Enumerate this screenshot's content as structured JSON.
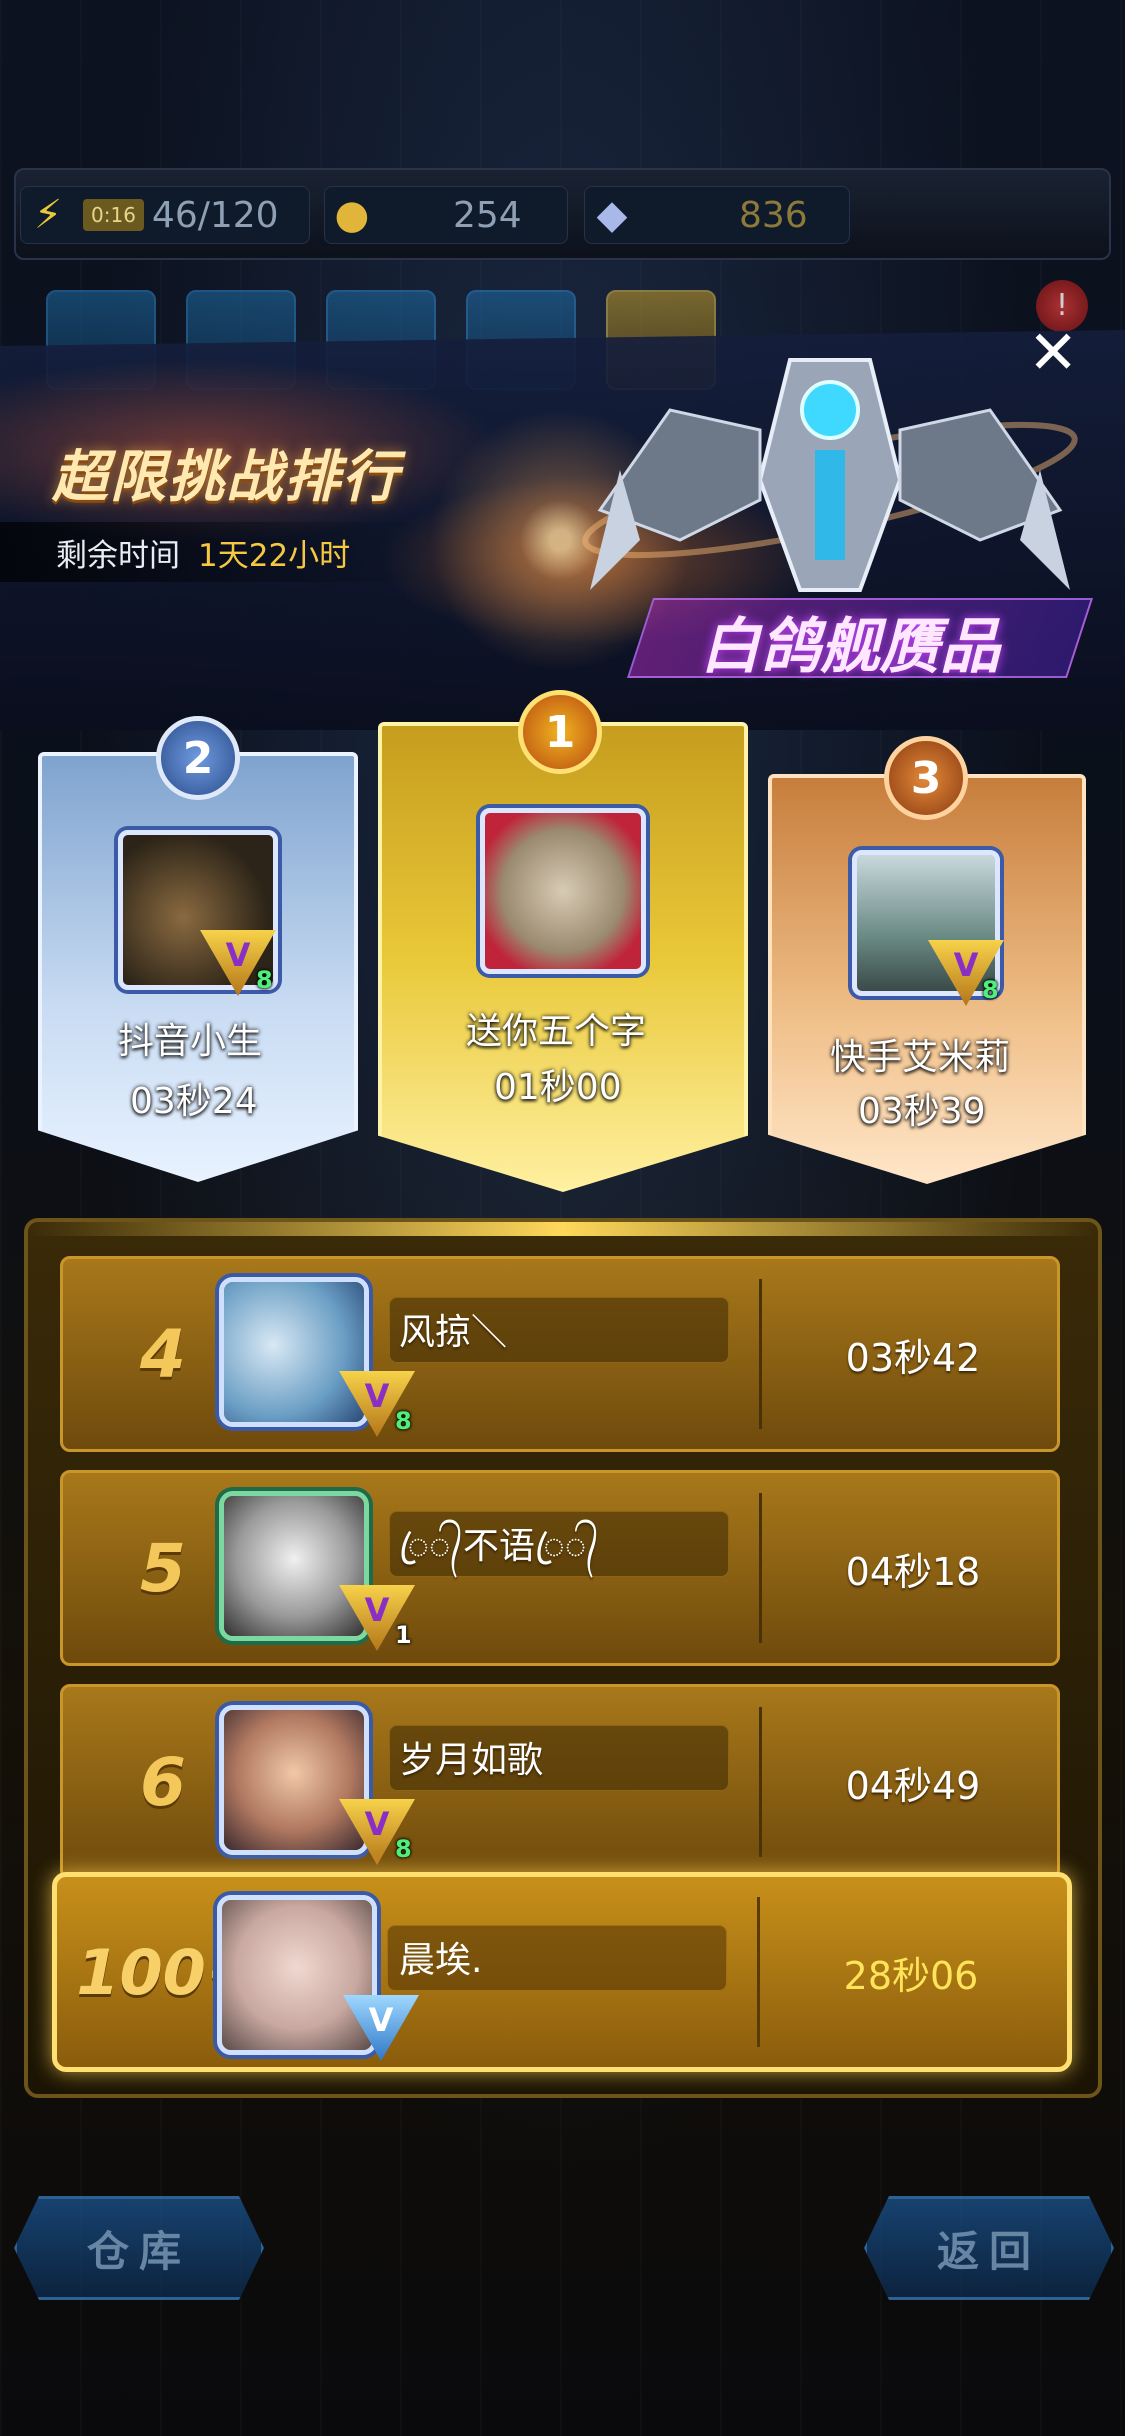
{
  "resources": {
    "energy_timer": "0:16",
    "energy": "46/120",
    "coins": "254",
    "gems": "836"
  },
  "popup": {
    "title": "超限挑战排行",
    "time_label": "剩余时间",
    "time_value": "1天22小时",
    "ship_name": "白鸽舰赝品"
  },
  "podium": [
    {
      "rank": "2",
      "name": "抖音小生",
      "time": "03秒24",
      "vip": "8"
    },
    {
      "rank": "1",
      "name": "送你五个字",
      "time": "01秒00",
      "vip": ""
    },
    {
      "rank": "3",
      "name": "快手艾米莉",
      "time": "03秒39",
      "vip": "8"
    }
  ],
  "rows": [
    {
      "rank": "4",
      "name": "风掠＼",
      "time": "03秒42",
      "vip": "8"
    },
    {
      "rank": "5",
      "name": "ꦿ᭄不语ꦿ᭄",
      "time": "04秒18",
      "vip": "1"
    },
    {
      "rank": "6",
      "name": "岁月如歌",
      "time": "04秒49",
      "vip": "8"
    }
  ],
  "me": {
    "rank": "100+",
    "name": "晨埃.",
    "time": "28秒06"
  },
  "buttons": {
    "warehouse": "仓库",
    "back": "返回"
  },
  "colors": {
    "gold": "#f4c842",
    "accent_purple": "#c64bff"
  }
}
